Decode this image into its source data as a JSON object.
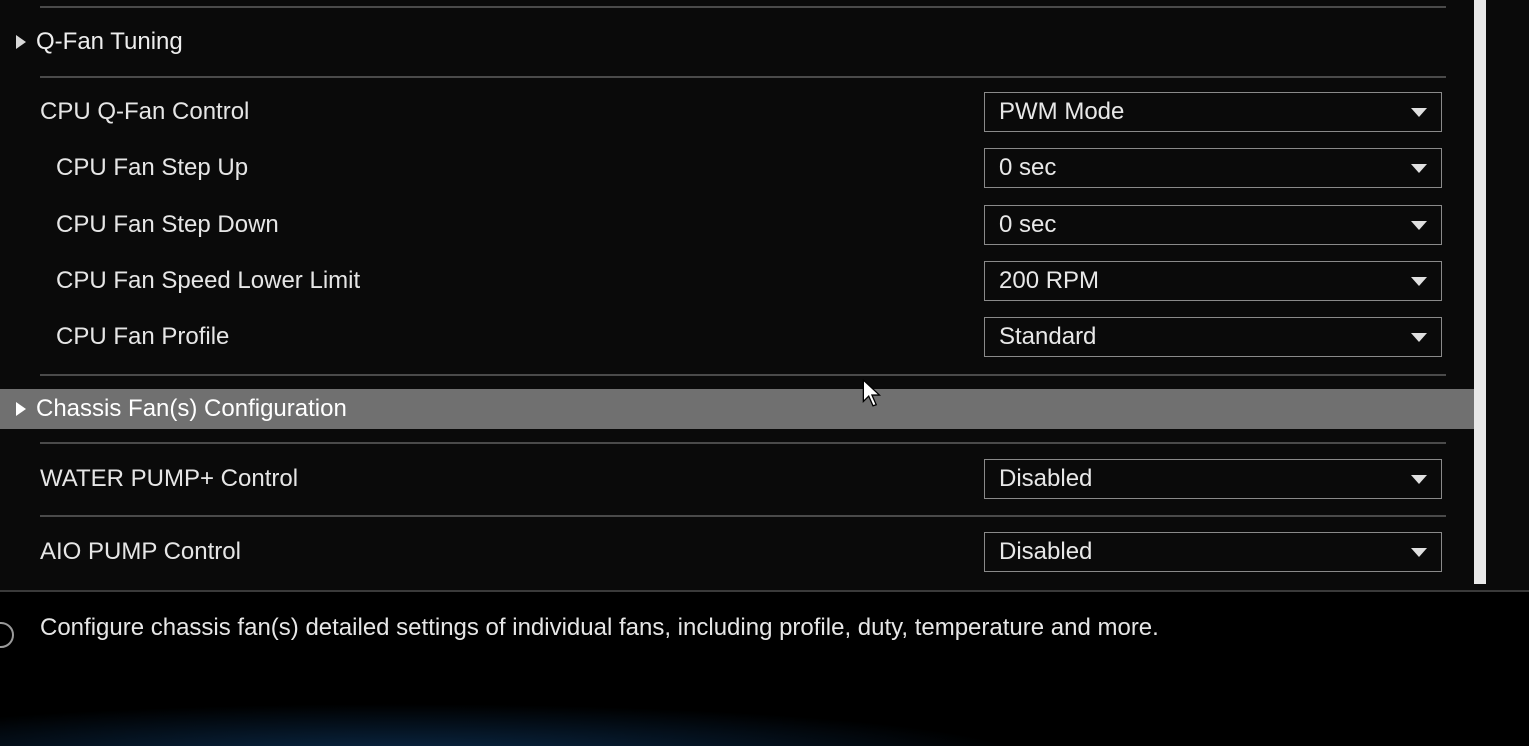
{
  "nav": {
    "qfan_tuning": "Q-Fan Tuning",
    "chassis_config": "Chassis Fan(s) Configuration"
  },
  "options": {
    "cpu_qfan_control": {
      "label": "CPU Q-Fan Control",
      "value": "PWM Mode"
    },
    "cpu_fan_step_up": {
      "label": "CPU Fan Step Up",
      "value": "0 sec"
    },
    "cpu_fan_step_down": {
      "label": "CPU Fan Step Down",
      "value": "0 sec"
    },
    "cpu_fan_speed_lower_limit": {
      "label": "CPU Fan Speed Lower Limit",
      "value": "200 RPM"
    },
    "cpu_fan_profile": {
      "label": "CPU Fan Profile",
      "value": "Standard"
    },
    "water_pump_plus": {
      "label": "WATER PUMP+ Control",
      "value": "Disabled"
    },
    "aio_pump": {
      "label": "AIO PUMP Control",
      "value": "Disabled"
    }
  },
  "help": {
    "text": "Configure chassis fan(s) detailed settings of individual fans, including profile, duty, temperature and more."
  }
}
